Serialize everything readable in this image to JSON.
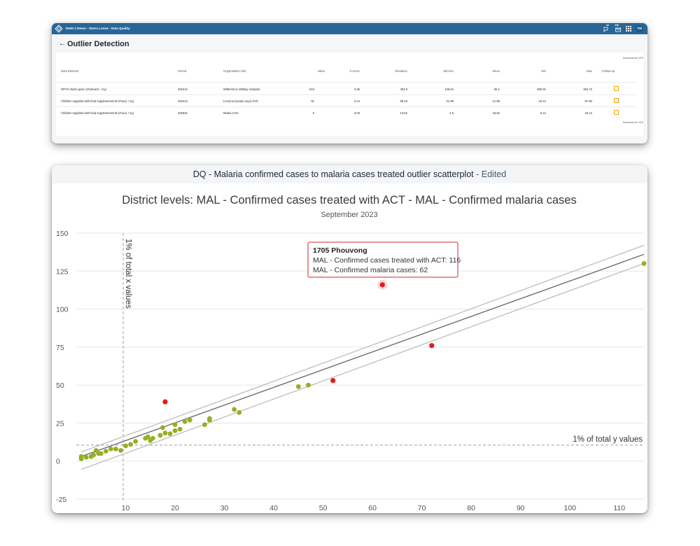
{
  "app_header": {
    "title": "DHIS 2 Demo - Sierra Leone - Data Quality",
    "chat_count": "42",
    "mail_count": "236",
    "user_initials": "TW"
  },
  "outlier_page": {
    "back_icon": "arrow-left-icon",
    "title": "Outlier Detection",
    "download_label": "Download as CSV",
    "columns": [
      "Data Element",
      "Period",
      "Organisation Unit",
      "Value",
      "Z-score",
      "Deviation",
      "Std Dev",
      "Mean",
      "Min",
      "Max",
      "Follow-up"
    ],
    "rows": [
      {
        "data_element": "OPV0 doses given (Outreach, <1y)",
        "period": "202412",
        "org_unit": "Wilberforce Military Hospital",
        "value": "510",
        "z_score": "3.35",
        "deviation": "453.9",
        "std_dev": "135.54",
        "mean": "56.1",
        "min": "-350.51",
        "max": "462.72"
      },
      {
        "data_element": "Children supplied with food supplemements (Fixed, <1y)",
        "period": "202412",
        "org_unit": "Levuma (Kandu Lepi) CHC",
        "value": "91",
        "z_score": "3.14",
        "deviation": "69.15",
        "std_dev": "21.99",
        "mean": "21.85",
        "min": "-44.12",
        "max": "87.83"
      },
      {
        "data_element": "Children supplied with food supplemements (Fixed, <1y)",
        "period": "202501",
        "org_unit": "Mobai CHC",
        "value": "6",
        "z_score": "3.03",
        "deviation": "13.62",
        "std_dev": "4.5",
        "mean": "19.62",
        "min": "6.12",
        "max": "33.12"
      }
    ]
  },
  "chart_panel": {
    "header_title": "DQ - Malaria confirmed cases to malaria cases treated outlier scatterplot",
    "header_suffix": " - Edited"
  },
  "chart_data": {
    "type": "scatter",
    "title": "District levels: MAL - Confirmed cases treated with ACT - MAL - Confirmed malaria cases",
    "subtitle": "September 2023",
    "xlim": [
      0,
      115
    ],
    "ylim": [
      -25,
      150
    ],
    "x_ticks": [
      10,
      20,
      30,
      40,
      50,
      60,
      70,
      80,
      90,
      100,
      110
    ],
    "y_ticks": [
      150,
      125,
      100,
      75,
      50,
      25,
      0,
      -25
    ],
    "grid": true,
    "colors": {
      "normal": "#93b023",
      "outlier": "#e11b1b",
      "regression": "#6e6e6e",
      "bounds": "#bdbdbd"
    },
    "threshold_x": {
      "value": 9.5,
      "label": "1% of total x values"
    },
    "threshold_y": {
      "value": 10.5,
      "label": "1% of total y values"
    },
    "regression_line": {
      "start": [
        1,
        3
      ],
      "end": [
        115,
        136
      ]
    },
    "upper_bound": {
      "start": [
        1,
        6
      ],
      "end": [
        115,
        142
      ]
    },
    "lower_bound": {
      "start": [
        1,
        -5.5
      ],
      "end": [
        115,
        130
      ]
    },
    "normal_points": [
      [
        1,
        3
      ],
      [
        1,
        1.5
      ],
      [
        2,
        2.5
      ],
      [
        3,
        3
      ],
      [
        3.5,
        4
      ],
      [
        4,
        7
      ],
      [
        4.5,
        5
      ],
      [
        5,
        5
      ],
      [
        6,
        6.5
      ],
      [
        7,
        8
      ],
      [
        8,
        8
      ],
      [
        9,
        7
      ],
      [
        10,
        10
      ],
      [
        11,
        11
      ],
      [
        12,
        13
      ],
      [
        14,
        15
      ],
      [
        14.5,
        16
      ],
      [
        15,
        13.5
      ],
      [
        15.5,
        15
      ],
      [
        17,
        17
      ],
      [
        17.5,
        22
      ],
      [
        18,
        18.5
      ],
      [
        19,
        18
      ],
      [
        20,
        20
      ],
      [
        20,
        24
      ],
      [
        21,
        21
      ],
      [
        22,
        26
      ],
      [
        23,
        27
      ],
      [
        26,
        24
      ],
      [
        27,
        28
      ],
      [
        27,
        27
      ],
      [
        32,
        34
      ],
      [
        33,
        32
      ],
      [
        45,
        49
      ],
      [
        47,
        50
      ],
      [
        115,
        130
      ]
    ],
    "outlier_points": [
      {
        "x": 18,
        "y": 39
      },
      {
        "x": 52,
        "y": 53
      },
      {
        "x": 72,
        "y": 76
      },
      {
        "x": 62,
        "y": 116,
        "highlighted": true
      }
    ],
    "tooltip": {
      "title": "1705 Phouvong",
      "line1": "MAL - Confirmed cases treated with ACT: 116",
      "line2": "MAL - Confirmed malaria cases: 62"
    }
  }
}
